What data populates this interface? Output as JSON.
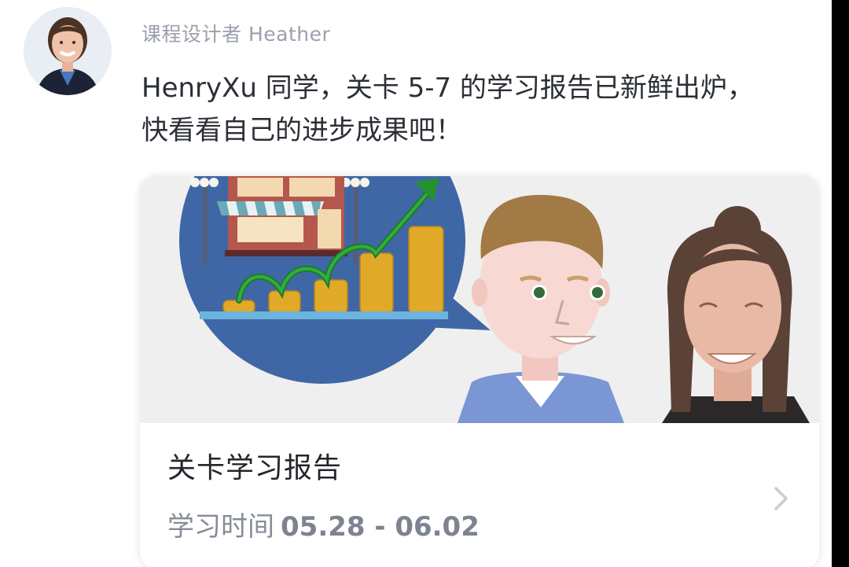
{
  "message": {
    "sender": "课程设计者 Heather",
    "line1": "HenryXu 同学，关卡 5-7 的学习报告已新鲜出炉，",
    "line2": "快看看自己的进步成果吧！"
  },
  "card": {
    "title": "关卡学习报告",
    "time_label": "学习时间",
    "date_range": "05.28 - 06.02"
  },
  "icons": {
    "avatar": "avatar-photo",
    "chevron": "chevron-right-icon",
    "illustration": "growth-report-illustration"
  },
  "colors": {
    "accent_blue": "#3f67a6",
    "coin_gold": "#e0a928",
    "arrow_green": "#23922f",
    "muted_text": "#9aa0ab"
  }
}
